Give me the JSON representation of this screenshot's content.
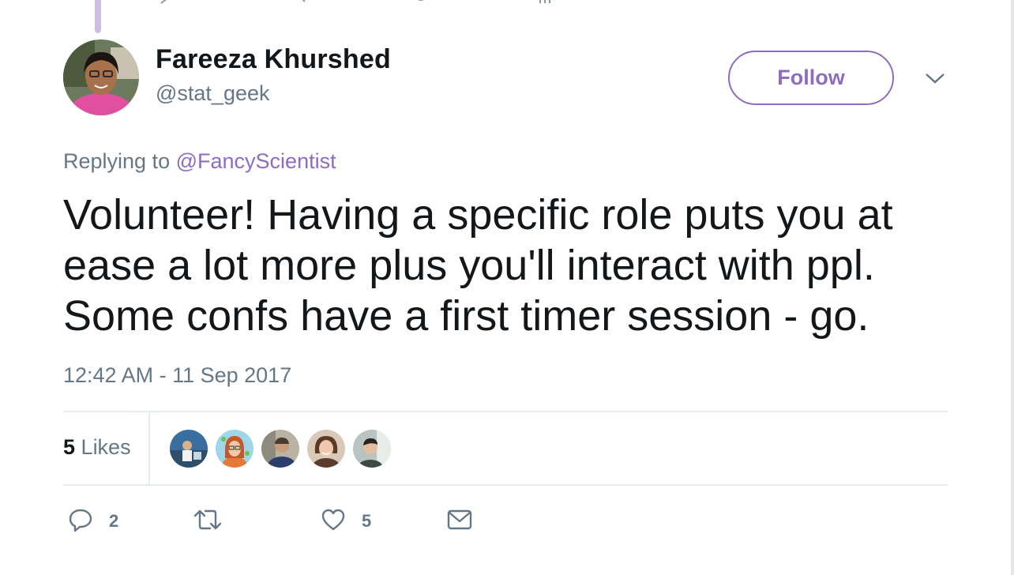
{
  "tweet": {
    "author": {
      "name": "Fareeza Khurshed",
      "handle": "@stat_geek"
    },
    "follow_label": "Follow",
    "replying_prefix": "Replying to",
    "replying_to": "@FancyScientist",
    "text": "Volunteer! Having a specific role puts you at ease a lot more plus you'll interact with ppl. Some confs have a first timer session - go.",
    "timestamp": "12:42 AM - 11 Sep 2017",
    "likes": {
      "count": "5",
      "label": "Likes"
    },
    "actions": {
      "reply_count": "2",
      "retweet_count": "",
      "like_count": "5"
    }
  },
  "colors": {
    "accent": "#8e6cbf",
    "secondary_text": "#657786",
    "divider": "#e6ecf0",
    "thread_line": "#cdbde3"
  },
  "icons": [
    "reply-icon",
    "retweet-icon",
    "heart-icon",
    "envelope-icon",
    "chevron-down-icon"
  ]
}
